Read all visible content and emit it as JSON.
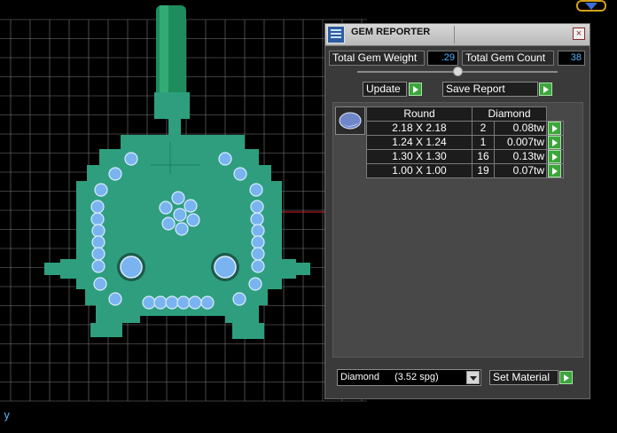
{
  "viewport": {
    "axis_label": "y",
    "background": "#000000",
    "grid_color": "#7a7a7a",
    "model_color": "#2e9e7f",
    "gem_color": "#7ab4f0",
    "axis_color": "#d22020"
  },
  "panel": {
    "title": "GEM REPORTER",
    "close_label": "×",
    "total_weight_label": "Total Gem Weight",
    "total_weight_value": ".29",
    "total_count_label": "Total Gem Count",
    "total_count_value": "38",
    "update_label": "Update",
    "save_report_label": "Save Report",
    "table": {
      "headers": [
        "Round",
        "Diamond"
      ],
      "rows": [
        {
          "size": "2.18 X 2.18",
          "qty": "2",
          "weight": "0.08tw"
        },
        {
          "size": "1.24 X 1.24",
          "qty": "1",
          "weight": "0.007tw"
        },
        {
          "size": "1.30 X 1.30",
          "qty": "16",
          "weight": "0.13tw"
        },
        {
          "size": "1.00 X 1.00",
          "qty": "19",
          "weight": "0.07tw"
        }
      ]
    },
    "material_select": {
      "name": "Diamond",
      "spg": "(3.52 spg)"
    },
    "set_material_label": "Set Material",
    "accent_go_color": "#3ca63c"
  }
}
